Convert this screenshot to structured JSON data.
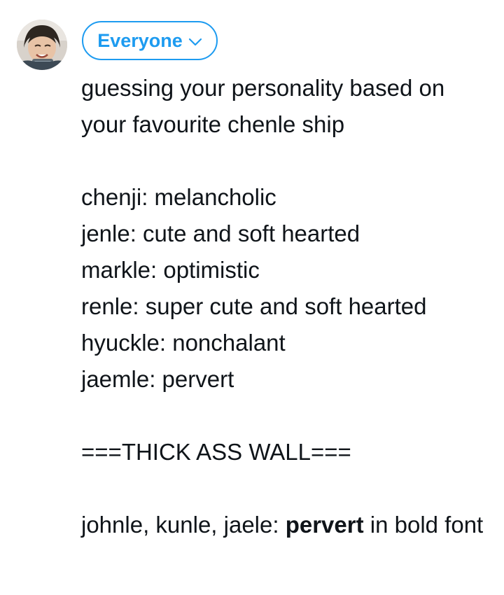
{
  "composer": {
    "avatar_icon": "profile-photo-avatar",
    "audience_label": "Everyone",
    "audience_icon": "chevron-down-icon",
    "accent_color": "#1d9bf0"
  },
  "tweet": {
    "intro_1": "guessing your personality based on",
    "intro_2": "your favourite chenle ship",
    "lines": [
      "chenji: melancholic",
      "jenle: cute and soft hearted",
      "markle: optimistic",
      "renle: super cute and soft hearted",
      "hyuckle: nonchalant",
      "jaemle: pervert"
    ],
    "wall": "===THICK ASS WALL===",
    "final_prefix": "johnle, kunle, jaele: ",
    "final_bold": "pervert",
    "final_suffix": " in bold font"
  }
}
